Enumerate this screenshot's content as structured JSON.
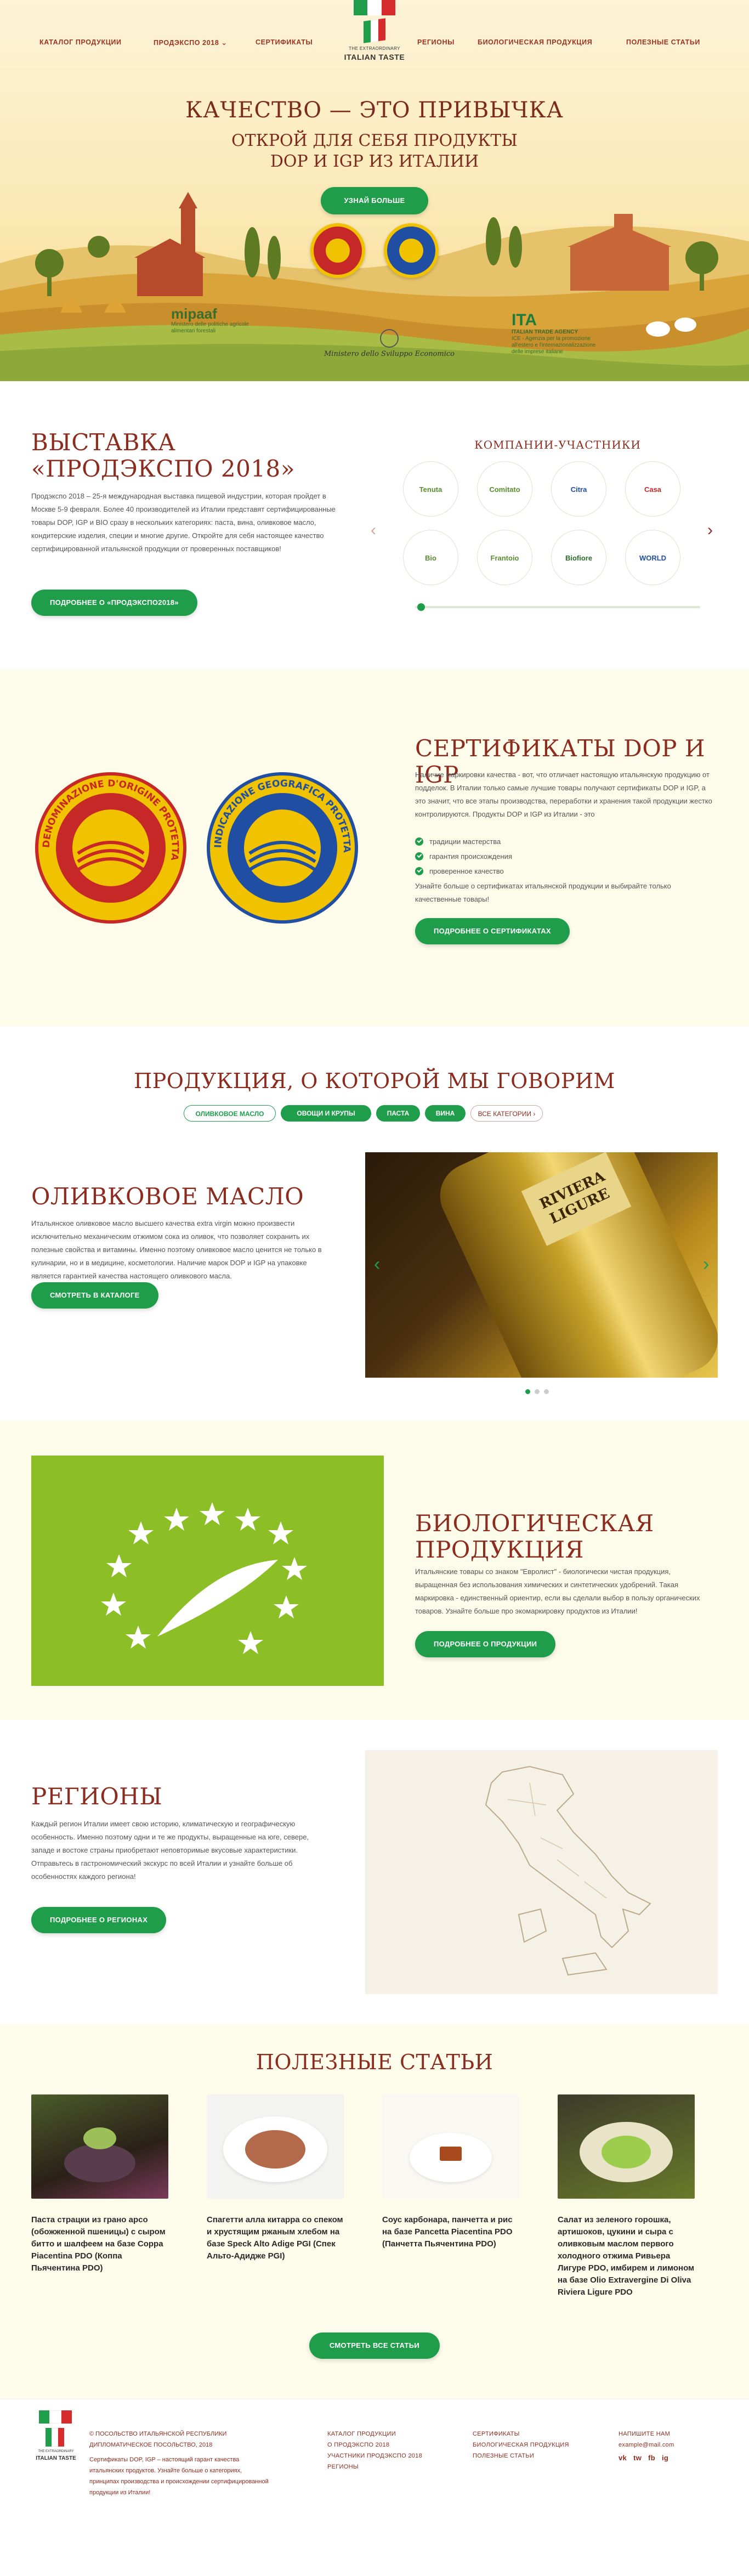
{
  "nav": {
    "catalog": "КАТАЛОГ ПРОДУКЦИИ",
    "prodexpo": "ПРОДЭКСПО 2018",
    "certificates": "СЕРТИФИКАТЫ",
    "regions": "РЕГИОНЫ",
    "bio": "БИОЛОГИЧЕСКАЯ ПРОДУКЦИЯ",
    "articles": "ПОЛЕЗНЫЕ СТАТЬИ"
  },
  "logo": {
    "line1": "THE EXTRAORDINARY",
    "line2": "ITALIAN TASTE"
  },
  "hero": {
    "title": "КАЧЕСТВО — ЭТО ПРИВЫЧКА",
    "subtitle_1": "ОТКРОЙ ДЛЯ СЕБЯ ПРОДУКТЫ",
    "subtitle_2": "DOP И IGP ИЗ ИТАЛИИ",
    "button": "УЗНАЙ БОЛЬШЕ",
    "partner_left": "Ministero delle politiche agricole alimentari forestali",
    "partner_mid": "Ministero dello Sviluppo Economico",
    "partner_right_1": "ITALIAN TRADE AGENCY",
    "partner_right_2": "ICE - Agenzia per la promozione all'estero e l'internazionalizzazione delle imprese italiane"
  },
  "expo": {
    "title_1": "ВЫСТАВКА",
    "title_2": "«ПРОДЭКСПО 2018»",
    "text": "Продэкспо 2018 – 25-я международная выставка пищевой индустрии, которая пройдет в Москве 5-9 февраля. Более 40 производителей из Италии представят сертифицированные товары DOP, IGP и BIO сразу в нескольких категориях: паста, вина, оливковое масло, кондитерские изделия, специи и многие другие. Откройте для себя настоящее качество сертифицированной итальянской продукции от проверенных поставщиков!",
    "button": "ПОДРОБНЕЕ О «ПРОДЭКСПО2018»",
    "companies_title": "КОМПАНИИ-УЧАСТНИКИ",
    "companies": [
      "Tenuta",
      "Comitato",
      "Citra",
      "Casa",
      "Bio",
      "Frantoio",
      "Biofiore",
      "WORLD"
    ]
  },
  "cert": {
    "title": "СЕРТИФИКАТЫ DOP И IGP",
    "dop_ring": "DENOMINAZIONE D'ORIGINE PROTETTA",
    "igp_ring": "INDICAZIONE GEOGRAFICA PROTETTA",
    "text_1": "Наличие маркировки качества - вот, что отличает настоящую итальянскую продукцию от подделок. В Италии только самые лучшие товары получают сертификаты DOP и IGP, а это значит, что все этапы производства, переработки и хранения такой продукции жестко контролируются. Продукты DOP и IGP из Италии - это",
    "bullets": [
      "традиции мастерства",
      "гарантия происхождения",
      "проверенное качество"
    ],
    "text_2": "Узнайте больше о сертификатах итальянской продукции и выбирайте только качественные товары!",
    "button": "ПОДРОБНЕЕ О СЕРТИФИКАТАХ"
  },
  "products": {
    "title": "ПРОДУКЦИЯ, О КОТОРОЙ МЫ ГОВОРИМ",
    "tabs": [
      "ОЛИВКОВОЕ МАСЛО",
      "ОВОЩИ И КРУПЫ",
      "ПАСТА",
      "ВИНА",
      "ВСЕ КАТЕГОРИИ ›"
    ],
    "item_title": "ОЛИВКОВОЕ МАСЛО",
    "item_text": "Итальянское оливковое масло высшего качества extra virgin можно произвести исключительно механическим отжимом сока из оливок, что позволяет сохранить их полезные свойства и витамины. Именно поэтому оливковое масло ценится не только в кулинарии, но и в медицине, косметологии. Наличие марок DOP и IGP на упаковке является гарантией качества настоящего оливкового масла.",
    "button": "СМОТРЕТЬ В КАТАЛОГЕ",
    "bottle_text": "RIVIERA LIGURE"
  },
  "bio": {
    "title_1": "БИОЛОГИЧЕСКАЯ",
    "title_2": "ПРОДУКЦИЯ",
    "text": "Итальянские товары со знаком \"Евролист\" - биологически чистая продукция, выращенная без использования химических и синтетических удобрений. Такая маркировка - единственный ориентир, если вы сделали выбор в пользу органических товаров. Узнайте больше про экомаркировку продуктов из Италии!",
    "button": "ПОДРОБНЕЕ О ПРОДУКЦИИ"
  },
  "regions": {
    "title": "РЕГИОНЫ",
    "text": "Каждый регион Италии имеет свою историю, климатическую и географическую особенность. Именно поэтому одни и те же продукты, выращенные на юге, севере, западе и востоке страны приобретают неповторимые вкусовые характеристики. Отправьтесь в гастрономический экскурс по всей Италии и узнайте больше об особенностях каждого региона!",
    "button": "ПОДРОБНЕЕ О РЕГИОНАХ"
  },
  "articles": {
    "title": "ПОЛЕЗНЫЕ СТАТЬИ",
    "items": [
      "Паста страцки из грано арсо (обожженной пшеницы) с сыром битто и шалфеем на базе Coppa Piacentina PDO (Коппа Пьячентина PDO)",
      "Спагетти алла китарра со спеком и хрустящим ржаным хлебом на базе Speck Alto Adige PGI (Спек Альто-Адидже PGI)",
      "Соус карбонара, панчетта и рис на базе Pancetta Piacentina PDO (Панчетта Пьячентина PDO)",
      "Салат из зеленого горошка, артишоков, цукини и сыра с оливковым маслом первого холодного отжима Ривьера Лигуре PDO, имбирем и лимоном на базе Olio Extravergine Di Oliva Riviera Ligure PDO"
    ],
    "button": "СМОТРЕТЬ ВСЕ СТАТЬИ"
  },
  "footer": {
    "copyright": "© ПОСОЛЬСТВО ИТАЛЬЯНСКОЙ РЕСПУБЛИКИ ДИПЛОМАТИЧЕСКОЕ ПОСОЛЬСТВО, 2018",
    "about": "Сертификаты DOP, IGP – настоящий гарант качества итальянских продуктов. Узнайте больше о категориях, принципах производства и происхождении сертифицированной продукции из Италии!",
    "col1": [
      "КАТАЛОГ ПРОДУКЦИИ",
      "О ПРОДЭКСПО 2018",
      "УЧАСТНИКИ ПРОДЭКСПО 2018",
      "РЕГИОНЫ"
    ],
    "col2": [
      "СЕРТИФИКАТЫ",
      "БИОЛОГИЧЕСКАЯ ПРОДУКЦИЯ",
      "ПОЛЕЗНЫЕ СТАТЬИ"
    ],
    "contact_label": "НАПИШИТЕ НАМ",
    "email": "example@mail.com",
    "social": [
      "vk",
      "tw",
      "fb",
      "ig"
    ]
  },
  "colors": {
    "green": "#1f9d4b",
    "brand_red": "#8c2c1f",
    "cream": "#fdfbea"
  }
}
